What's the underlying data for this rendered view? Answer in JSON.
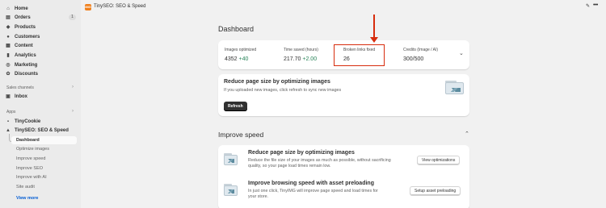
{
  "sidebar": {
    "items": [
      {
        "label": "Home",
        "icon": "home-icon",
        "glyph": "⌂"
      },
      {
        "label": "Orders",
        "icon": "orders-icon",
        "glyph": "▤",
        "badge": "1"
      },
      {
        "label": "Products",
        "icon": "tag-icon",
        "glyph": "◆"
      },
      {
        "label": "Customers",
        "icon": "person-icon",
        "glyph": "●"
      },
      {
        "label": "Content",
        "icon": "content-icon",
        "glyph": "▦"
      },
      {
        "label": "Analytics",
        "icon": "analytics-icon",
        "glyph": "▮"
      },
      {
        "label": "Marketing",
        "icon": "marketing-icon",
        "glyph": "◎"
      },
      {
        "label": "Discounts",
        "icon": "discount-icon",
        "glyph": "✿"
      }
    ],
    "sales_channels_label": "Sales channels",
    "inbox": {
      "label": "Inbox",
      "glyph": "▣"
    },
    "apps_label": "Apps",
    "apps": [
      {
        "label": "TinyCookie",
        "glyph": "▪"
      },
      {
        "label": "TinySEO: SEO & Speed",
        "glyph": "▲"
      }
    ],
    "subitems": [
      "Dashboard",
      "Optimize images",
      "Improve speed",
      "Improve SEO",
      "Improve with AI",
      "Site audit"
    ],
    "view_more": "View more"
  },
  "appbar": {
    "icon_text": "IMG",
    "title": "TinySEO: SEO & Speed",
    "pin_glyph": "✎",
    "more_glyph": "•••"
  },
  "main": {
    "title": "Dashboard",
    "stats": [
      {
        "label": "Images optimized",
        "value": "4352",
        "delta": "+40"
      },
      {
        "label": "Time saved (hours)",
        "value": "217.70",
        "delta": "+2.00"
      },
      {
        "label": "Broken links fixed",
        "value": "26",
        "delta": ""
      },
      {
        "label": "Credits (Image / AI)",
        "value": "300/500",
        "delta": ""
      }
    ],
    "stats_chevron": "⌄",
    "banner": {
      "title": "Reduce page size by optimizing images",
      "desc": "If you uploaded new images, click refresh to sync new images",
      "button": "Refresh"
    },
    "improve_section": {
      "title": "Improve speed",
      "chevron": "⌃",
      "items": [
        {
          "title": "Reduce page size by optimizing images",
          "desc_line1": "Reduce the file size of your images as much as possible, without sacrificing",
          "desc_line2": "quality, so your page load times remain low.",
          "button": "View optimizations"
        },
        {
          "title": "Improve browsing speed with asset preloading",
          "desc_line1": "In just one click, TinyIMG will improve page speed and load times for",
          "desc_line2": "your store.",
          "button": "Setup asset preloading"
        }
      ]
    }
  },
  "colors": {
    "accent_red": "#d72c0d",
    "positive_green": "#29845a",
    "link_blue": "#005bd3",
    "app_orange": "#f0801c"
  }
}
